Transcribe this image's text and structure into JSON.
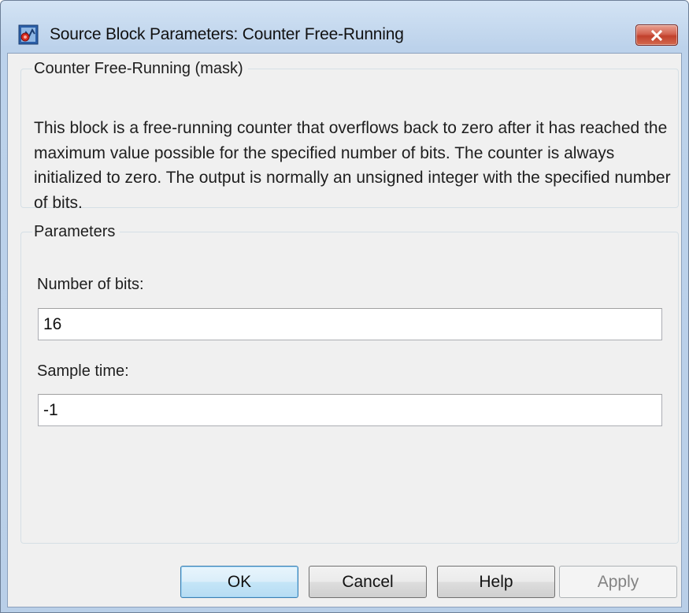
{
  "window": {
    "title": "Source Block Parameters: Counter Free-Running",
    "icon": "simulink-block-icon",
    "close_icon": "close-x-icon"
  },
  "mask": {
    "group_title": "Counter Free-Running (mask)",
    "description": "This block is a free-running counter that overflows back to zero after it has reached the maximum value possible for the specified number of bits. The counter is always initialized to zero.  The output is normally an unsigned integer with the specified number of bits."
  },
  "parameters": {
    "group_title": "Parameters",
    "number_of_bits": {
      "label": "Number of bits:",
      "value": "16"
    },
    "sample_time": {
      "label": "Sample time:",
      "value": "-1"
    }
  },
  "buttons": {
    "ok": "OK",
    "cancel": "Cancel",
    "help": "Help",
    "apply": "Apply"
  },
  "colors": {
    "close_button": "#c7432f",
    "default_button_border": "#3c7fb1",
    "dialog_background": "#f0f0f0"
  }
}
